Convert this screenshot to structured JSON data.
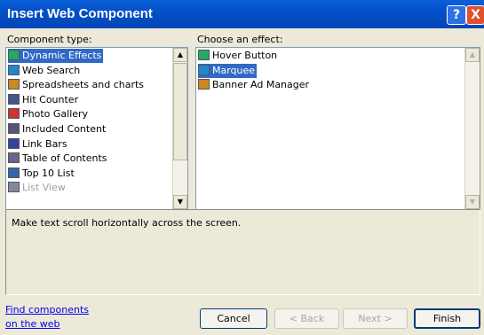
{
  "window": {
    "title": "Insert Web Component",
    "help_glyph": "?",
    "close_glyph": "X"
  },
  "component_type": {
    "label": "Component type:",
    "items": [
      {
        "label": "Dynamic Effects",
        "icon": "dynamic-effects-icon",
        "selected": true
      },
      {
        "label": "Web Search",
        "icon": "web-search-icon"
      },
      {
        "label": "Spreadsheets and charts",
        "icon": "spreadsheet-icon"
      },
      {
        "label": "Hit Counter",
        "icon": "hit-counter-icon"
      },
      {
        "label": "Photo Gallery",
        "icon": "photo-gallery-icon"
      },
      {
        "label": "Included Content",
        "icon": "included-content-icon"
      },
      {
        "label": "Link Bars",
        "icon": "link-bars-icon"
      },
      {
        "label": "Table of Contents",
        "icon": "table-of-contents-icon"
      },
      {
        "label": "Top 10 List",
        "icon": "top-10-list-icon"
      },
      {
        "label": "List View",
        "icon": "list-view-icon",
        "disabled": true
      }
    ]
  },
  "effect": {
    "label": "Choose an effect:",
    "items": [
      {
        "label": "Hover Button",
        "icon": "hover-button-icon"
      },
      {
        "label": "Marquee",
        "icon": "marquee-icon",
        "selected": true
      },
      {
        "label": "Banner Ad Manager",
        "icon": "banner-ad-icon"
      }
    ]
  },
  "description": "Make text scroll horizontally across the screen.",
  "find_link": {
    "line1": "Find components",
    "line2": "on the web"
  },
  "buttons": {
    "cancel": "Cancel",
    "back": "< Back",
    "next": "Next >",
    "finish": "Finish"
  },
  "colors": {
    "selection": "#316ac5",
    "titlebar": "#0350c8",
    "face": "#ece9d8"
  }
}
